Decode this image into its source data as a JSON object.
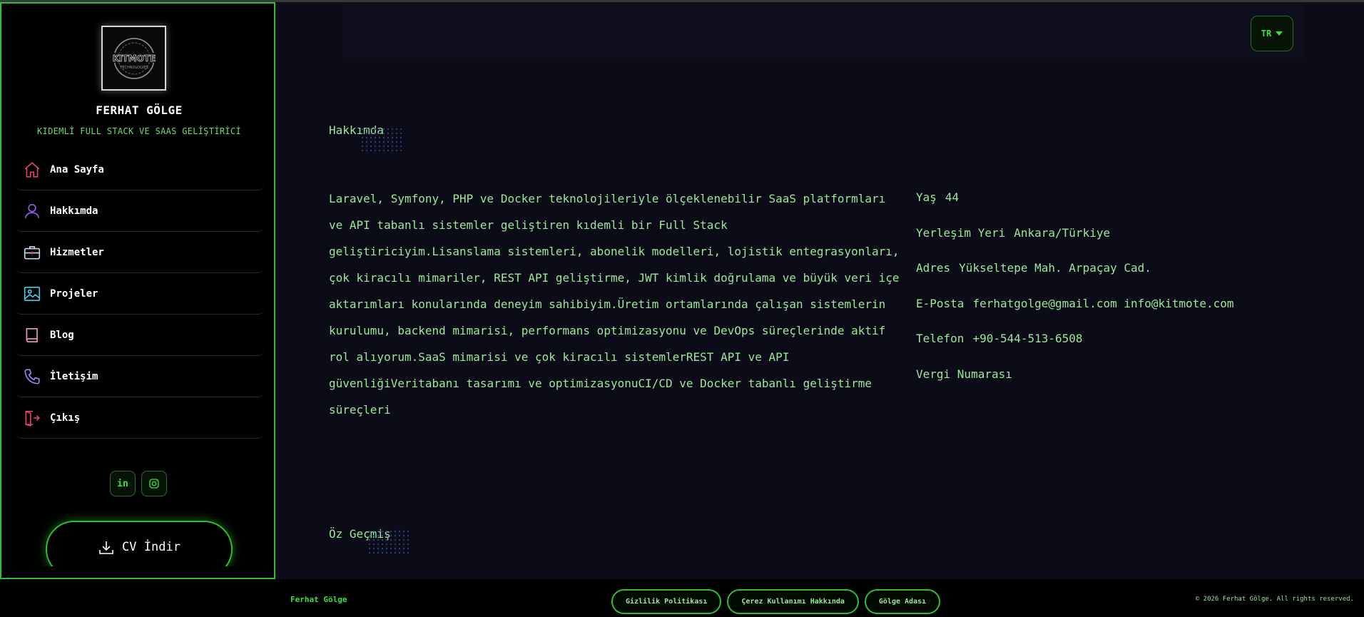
{
  "sidebar": {
    "logo_text": "KITMOTE",
    "logo_sub": "TECHNOLOGIES",
    "name": "FERHAT GÖLGE",
    "subtitle": "KIDEMLİ FULL STACK VE SAAS GELİŞTİRİCİ",
    "items": [
      {
        "label": "Ana Sayfa",
        "icon": "home-icon",
        "color": "#e0466a"
      },
      {
        "label": "Hakkımda",
        "icon": "user-icon",
        "color": "#9a5cf0"
      },
      {
        "label": "Hizmetler",
        "icon": "briefcase-icon",
        "color": "#c8d8e8"
      },
      {
        "label": "Projeler",
        "icon": "image-icon",
        "color": "#4fc8e8"
      },
      {
        "label": "Blog",
        "icon": "book-icon",
        "color": "#e8a0c8"
      },
      {
        "label": "İletişim",
        "icon": "phone-icon",
        "color": "#9a8cf0"
      },
      {
        "label": "Çıkış",
        "icon": "logout-icon",
        "color": "#e0466a"
      }
    ],
    "socials": [
      {
        "label": "in",
        "icon": "linkedin-icon"
      },
      {
        "label": "",
        "icon": "instagram-icon"
      }
    ],
    "cv_button": "CV İndir"
  },
  "header": {
    "language": "TR"
  },
  "about": {
    "title": "Hakkımda",
    "text": "Laravel, Symfony, PHP ve Docker teknolojileriyle ölçeklenebilir SaaS platformları ve API tabanlı sistemler geliştiren kıdemli bir Full Stack geliştiriciyim.Lisanslama sistemleri, abonelik modelleri, lojistik entegrasyonları, çok kiracılı mimariler, REST API geliştirme, JWT kimlik doğrulama ve büyük veri içe aktarımları konularında deneyim sahibiyim.Üretim ortamlarında çalışan sistemlerin kurulumu, backend mimarisi, performans optimizasyonu ve DevOps süreçlerinde aktif rol alıyorum.SaaS mimarisi ve çok kiracılı sistemlerREST API ve API güvenliğiVeritabanı tasarımı ve optimizasyonuCI/CD ve Docker tabanlı geliştirme süreçleri",
    "info": [
      {
        "key": "Yaş",
        "value": "44"
      },
      {
        "key": "Yerleşim Yeri",
        "value": "Ankara/Türkiye"
      },
      {
        "key": "Adres",
        "value": "Yükseltepe Mah. Arpaçay Cad."
      },
      {
        "key": "E-Posta",
        "value": "ferhatgolge@gmail.com info@kitmote.com"
      },
      {
        "key": "Telefon",
        "value": "+90-544-513-6508"
      },
      {
        "key": "Vergi Numarası",
        "value": ""
      }
    ]
  },
  "resume": {
    "title": "Öz Geçmiş"
  },
  "footer": {
    "brand": "Ferhat Gölge",
    "links": [
      "Gizlilik Politikası",
      "Çerez Kullanımı Hakkında",
      "Gölge Adası"
    ],
    "copyright": "© 2026 Ferhat Gölge. All rights reserved."
  },
  "colors": {
    "accent": "#2fbf2f",
    "text": "#9be89b",
    "background": "#0c0c18"
  }
}
